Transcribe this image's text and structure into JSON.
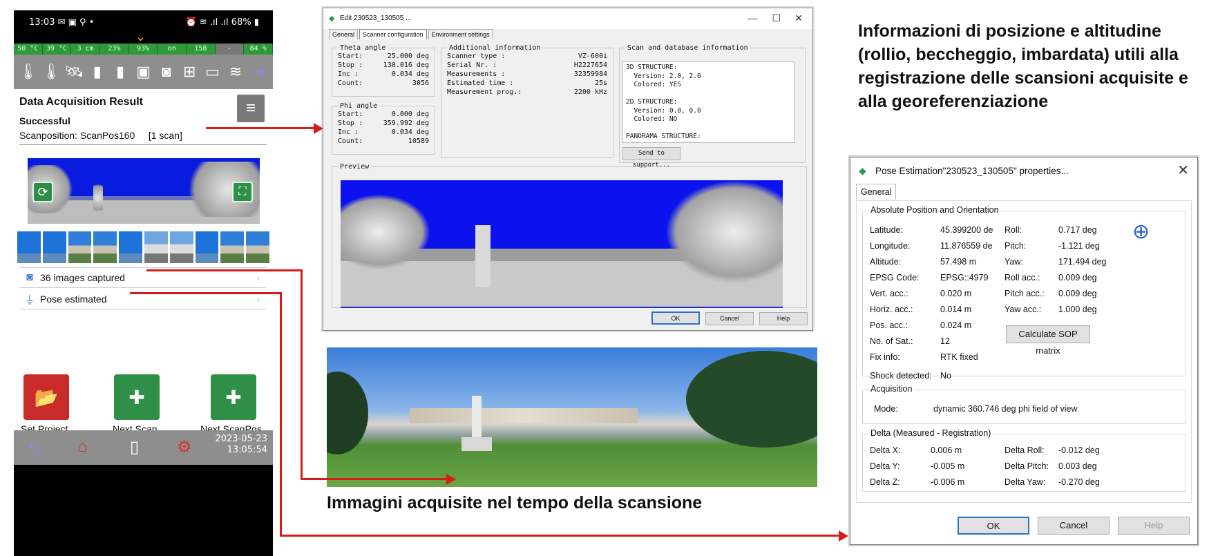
{
  "phone": {
    "status": {
      "time": "13:03 ✉ ▣ ⚲ •",
      "right": "⏰ ≋ .ıl .ıl 68% ▮"
    },
    "sensors": [
      "50 °C",
      "39 °C",
      "3 cm",
      "23%",
      "93%",
      "on",
      "158",
      "-",
      "84 %"
    ],
    "title": "Data Acquisition Result",
    "status_text": "Successful",
    "scanposition_label": "Scanposition:",
    "scanposition_value": "ScanPos160",
    "scan_count": "[1 scan]",
    "images_captured": "36 images captured",
    "pose_estimated": "Pose estimated",
    "buttons": {
      "set_project": "Set Project",
      "next_scan": "Next Scan",
      "next_scanpos": "Next ScanPos"
    },
    "nav_date": "2023-05-23",
    "nav_time": "13:05:54"
  },
  "edit_window": {
    "title": "Edit 230523_130505 ...",
    "tabs": [
      "General",
      "Scanner configuration",
      "Environment settings"
    ],
    "theta": {
      "legend": "Theta angle",
      "rows": [
        [
          "Start:",
          "25.000 deg"
        ],
        [
          "Stop  :",
          "130.016 deg"
        ],
        [
          "Inc   :",
          "0.034 deg"
        ],
        [
          "Count:",
          "3056"
        ]
      ]
    },
    "phi": {
      "legend": "Phi angle",
      "rows": [
        [
          "Start:",
          "0.000 deg"
        ],
        [
          "Stop  :",
          "359.992 deg"
        ],
        [
          "Inc   :",
          "0.034 deg"
        ],
        [
          "Count:",
          "10589"
        ]
      ]
    },
    "additional": {
      "legend": "Additional information",
      "rows": [
        [
          "Scanner type      :",
          "VZ-600i"
        ],
        [
          "Serial Nr.        :",
          "H2227654"
        ],
        [
          "Measurements      :",
          "32359984"
        ],
        [
          "Estimated time    :",
          "25s"
        ],
        [
          "Measurement prog.:",
          "2200 kHz"
        ]
      ]
    },
    "scan_db": {
      "legend": "Scan and database information",
      "text": "3D STRUCTURE:\n  Version: 2.0, 2.0\n  Colored: YES\n\n2D STRUCTURE:\n  Version: 0.0, 0.0\n  Colored: NO\n\nPANORAMA STRUCTURE:"
    },
    "send_support": "Send to support...",
    "preview_legend": "Preview",
    "ok": "OK",
    "cancel": "Cancel",
    "help": "Help"
  },
  "captions": {
    "top_right": "Informazioni di posizione e altitudine (rollio, beccheggio, imbardata) utili alla registrazione delle scansioni acquisite e alla georeferenziazione",
    "photo": "Immagini acquisite nel tempo della scansione"
  },
  "pose_window": {
    "title": "Pose Estimation\"230523_130505\" properties...",
    "tab": "General",
    "abs_group": "Absolute Position and Orientation",
    "left_rows": [
      [
        "Latitude:",
        "45.399200 de"
      ],
      [
        "Longitude:",
        "11.876559 de"
      ],
      [
        "Altitude:",
        "57.498 m"
      ],
      [
        "EPSG Code:",
        "EPSG::4979"
      ],
      [
        "Vert. acc.:",
        "0.020 m"
      ],
      [
        "Horiz. acc.:",
        "0.014 m"
      ],
      [
        "Pos. acc.:",
        "0.024 m"
      ],
      [
        "No. of Sat.:",
        "12"
      ],
      [
        "Fix info:",
        "RTK fixed"
      ]
    ],
    "right_rows": [
      [
        "Roll:",
        "0.717 deg"
      ],
      [
        "Pitch:",
        "-1.121 deg"
      ],
      [
        "Yaw:",
        "171.494 deg"
      ],
      [
        "Roll acc.:",
        "0.009 deg"
      ],
      [
        "Pitch acc.:",
        "0.009 deg"
      ],
      [
        "Yaw acc.:",
        "1.000 deg"
      ]
    ],
    "calc_sop": "Calculate SOP matrix",
    "shock_label": "Shock detected:",
    "shock_value": "No",
    "acq_group": "Acquisition",
    "mode_label": "Mode:",
    "mode_value": "dynamic 360.746 deg phi field of view",
    "delta_group": "Delta (Measured - Registration)",
    "delta_left": [
      [
        "Delta X:",
        "0.006 m"
      ],
      [
        "Delta Y:",
        "-0.005 m"
      ],
      [
        "Delta Z:",
        "-0.006 m"
      ]
    ],
    "delta_right": [
      [
        "Delta Roll:",
        "-0.012 deg"
      ],
      [
        "Delta Pitch:",
        "0.003 deg"
      ],
      [
        "Delta Yaw:",
        "-0.270 deg"
      ]
    ],
    "ok": "OK",
    "cancel": "Cancel",
    "help": "Help"
  },
  "colors": {
    "arrow": "#d81b1b",
    "sensor_green": "#2f9a3a",
    "phone_gray": "#8e8e8e",
    "scan_blue": "#0b12ee"
  }
}
